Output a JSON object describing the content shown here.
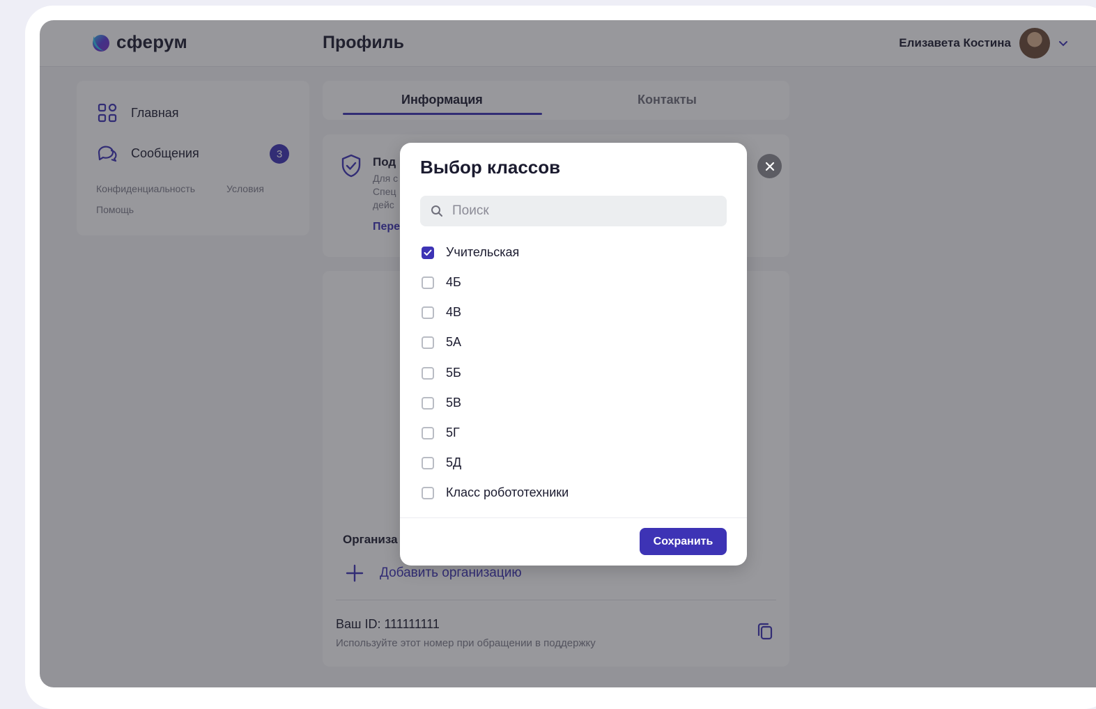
{
  "brand": {
    "name": "сферум"
  },
  "header": {
    "title": "Профиль",
    "user_name": "Елизавета Костина"
  },
  "sidebar": {
    "items": [
      {
        "label": "Главная",
        "icon": "grid-icon"
      },
      {
        "label": "Сообщения",
        "icon": "chat-icon",
        "badge": "3"
      }
    ],
    "links": [
      "Конфиденциальность",
      "Условия",
      "Помощь"
    ]
  },
  "tabs": [
    {
      "label": "Информация",
      "active": true
    },
    {
      "label": "Контакты",
      "active": false
    }
  ],
  "card_partial": {
    "title": "Под",
    "lines": [
      "Для с",
      "Спец",
      "дейс"
    ],
    "link": "Пере"
  },
  "organization": {
    "title": "Организа",
    "add_label": "Добавить организацию",
    "id_text": "Ваш ID: 111111111",
    "id_hint": "Используйте этот номер при обращении в поддержку"
  },
  "modal": {
    "title": "Выбор классов",
    "search_placeholder": "Поиск",
    "options": [
      {
        "label": "Учительская",
        "checked": true
      },
      {
        "label": "4Б",
        "checked": false
      },
      {
        "label": "4В",
        "checked": false
      },
      {
        "label": "5А",
        "checked": false
      },
      {
        "label": "5Б",
        "checked": false
      },
      {
        "label": "5В",
        "checked": false
      },
      {
        "label": "5Г",
        "checked": false
      },
      {
        "label": "5Д",
        "checked": false
      },
      {
        "label": "Класс робототехники",
        "checked": false
      }
    ],
    "save_label": "Сохранить"
  },
  "colors": {
    "accent": "#3d33b5",
    "overlay": "rgba(40,40,48,0.48)"
  }
}
